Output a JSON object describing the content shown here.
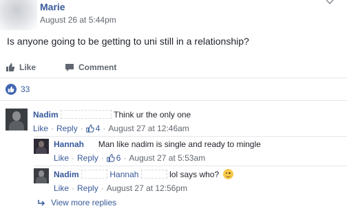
{
  "post": {
    "author": "Marie",
    "timestamp": "August 26 at 5:44pm",
    "text": "Is anyone going to be getting to uni still in a relationship?",
    "actions": {
      "like": "Like",
      "comment": "Comment"
    },
    "like_count": "33",
    "icons": {
      "menu": "chevron-down-icon",
      "like": "thumbs-up-icon",
      "comment": "speech-bubble-icon"
    }
  },
  "comments": [
    {
      "author": "Nadim",
      "text": "Think ur the only one",
      "like_label": "Like",
      "reply_label": "Reply",
      "reactions": "4",
      "timestamp": "August 27 at 12:46am"
    },
    {
      "author": "Hannah",
      "text": "Man like nadim is single and ready to mingle",
      "like_label": "Like",
      "reply_label": "Reply",
      "reactions": "6",
      "timestamp": "August 27 at 5:53am"
    },
    {
      "author": "Nadim",
      "mention": "Hannah",
      "text": "lol says who?",
      "emoji": "winking-face-emoji",
      "like_label": "Like",
      "reply_label": "Reply",
      "timestamp": "August 27 at 12:56pm"
    }
  ],
  "view_more": "View more replies",
  "colors": {
    "link": "#365899",
    "meta": "#616770",
    "like_badge": "#4267b2",
    "divider": "#e5e6e9"
  }
}
